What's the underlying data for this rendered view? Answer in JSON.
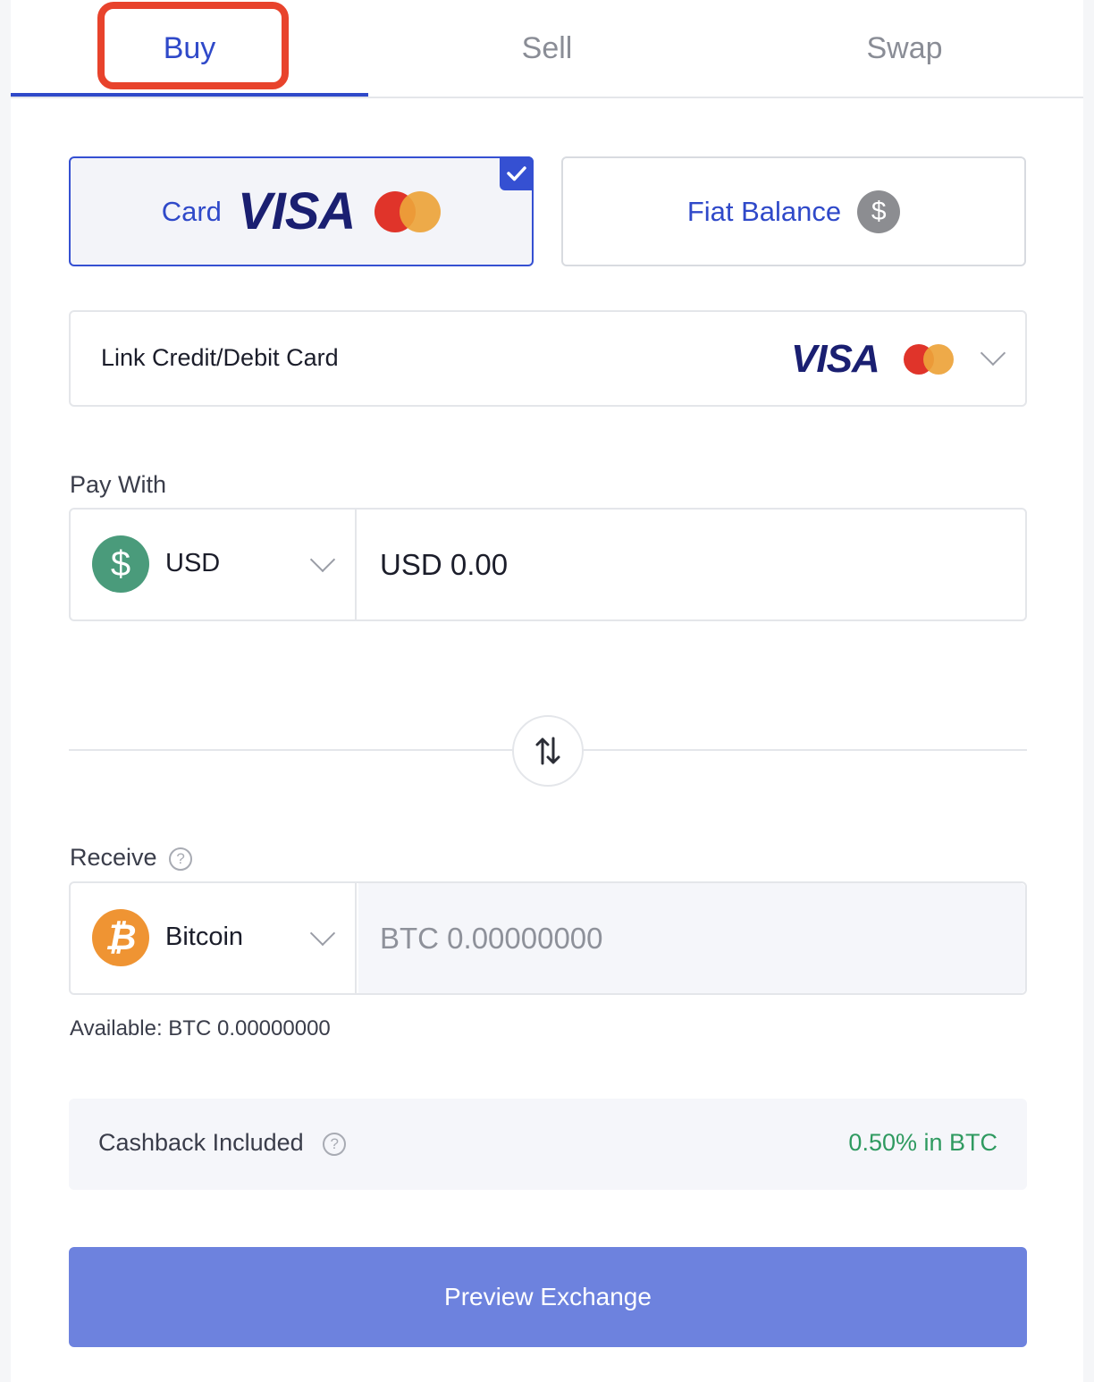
{
  "tabs": {
    "buy": "Buy",
    "sell": "Sell",
    "swap": "Swap",
    "active": "Buy"
  },
  "methods": {
    "card_label": "Card",
    "card_brand": "VISA",
    "fiat_label": "Fiat Balance",
    "fiat_symbol": "$"
  },
  "link_card": {
    "label": "Link Credit/Debit Card",
    "brand": "VISA"
  },
  "pay_with": {
    "label": "Pay With",
    "currency": "USD",
    "currency_symbol": "$",
    "amount": "USD 0.00"
  },
  "receive": {
    "label": "Receive",
    "help": "?",
    "currency": "Bitcoin",
    "currency_symbol": "₿",
    "amount_placeholder": "BTC 0.00000000",
    "available": "Available: BTC 0.00000000"
  },
  "cashback": {
    "label": "Cashback Included",
    "help": "?",
    "value": "0.50% in BTC"
  },
  "actions": {
    "preview": "Preview Exchange"
  },
  "colors": {
    "accent": "#2f49c9",
    "highlight": "#e8432c",
    "usd_coin": "#4a9b7b",
    "btc_coin": "#ef9433",
    "cashback_green": "#2f9a60",
    "button": "#6d82de"
  },
  "icons": [
    "check-icon",
    "mastercard-icon",
    "dollar-icon",
    "chevron-down-icon",
    "swap-arrows-icon",
    "help-icon",
    "bitcoin-icon"
  ]
}
